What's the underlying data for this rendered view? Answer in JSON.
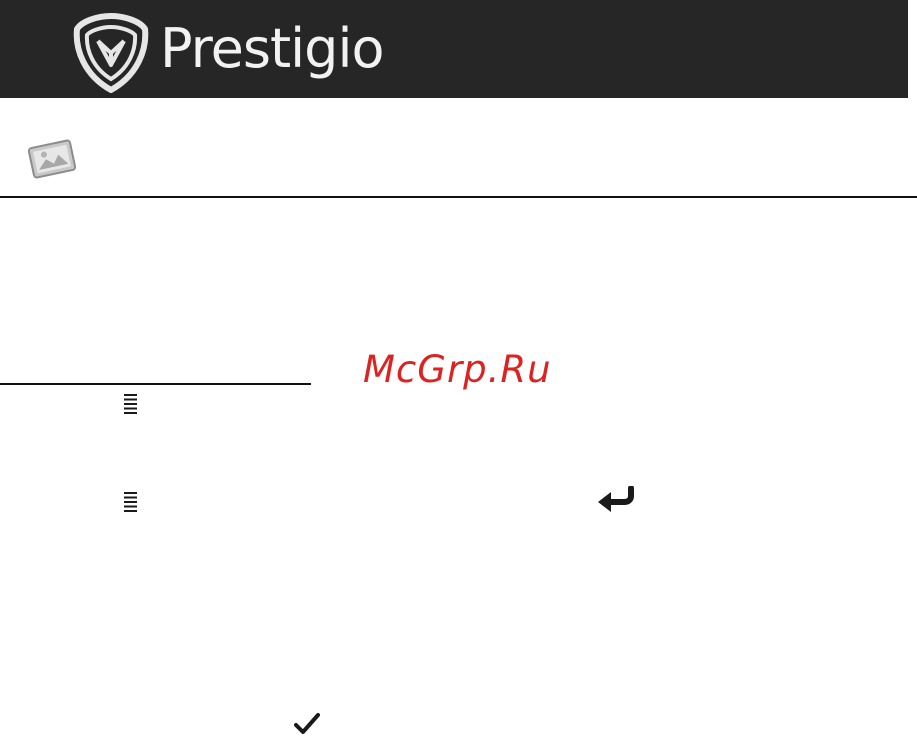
{
  "header": {
    "brand": "Prestigio",
    "logo_icon": "prestigio-shield-logo-icon",
    "background_color": "#262626"
  },
  "section": {
    "icon": "photo-card-icon"
  },
  "watermark": {
    "text": "McGrp.Ru",
    "color": "#dd2222"
  },
  "inline_icons": [
    "menu-icon",
    "menu-icon",
    "back-arrow-icon",
    "checkmark-icon"
  ]
}
